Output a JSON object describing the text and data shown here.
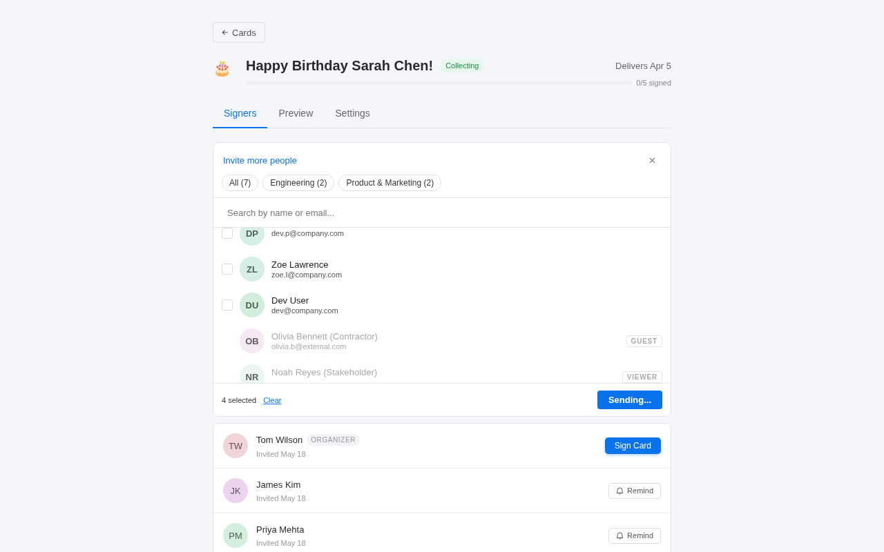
{
  "back_button": {
    "label": "Cards"
  },
  "header": {
    "emoji": "🎂",
    "title": "Happy Birthday Sarah Chen!",
    "status": "Collecting",
    "delivery": "Delivers Apr 5",
    "progress": {
      "level": 0,
      "reading": "0/5 signed"
    }
  },
  "tabs": [
    {
      "label": "Signers",
      "selected": true
    },
    {
      "label": "Preview",
      "selected": false
    },
    {
      "label": "Settings",
      "selected": false
    }
  ],
  "invite_panel": {
    "title": "Invite more people",
    "filters": [
      "All (7)",
      "Engineering (2)",
      "Product & Marketing (2)"
    ],
    "search": {
      "placeholder": "Search by name or email..."
    },
    "people": [
      {
        "initials": "DP",
        "email": "dev.p@company.com",
        "color": "#d5eee6",
        "disabled": false,
        "checked": false
      },
      {
        "initials": "ZL",
        "name": "Zoe Lawrence",
        "email": "zoe.l@company.com",
        "color": "#d5eee6",
        "disabled": false,
        "checked": false
      },
      {
        "initials": "DU",
        "name": "Dev User",
        "email": "dev@company.com",
        "color": "#d3eedc",
        "disabled": false,
        "checked": false
      },
      {
        "initials": "OB",
        "name": "Olivia Bennett (Contractor)",
        "email": "olivia.b@external.com",
        "color": "#f6e9f5",
        "disabled": true,
        "badge": "GUEST"
      },
      {
        "initials": "NR",
        "name": "Noah Reyes (Stakeholder)",
        "color": "#e9f6f2",
        "disabled": true,
        "badge": "VIEWER"
      }
    ],
    "footer": {
      "selected_count": "4 selected",
      "clear": "Clear",
      "send": "Sending..."
    }
  },
  "signers": [
    {
      "initials": "TW",
      "name": "Tom Wilson",
      "role": "ORGANIZER",
      "invited": "Invited May 18",
      "color": "#f0d4d8",
      "action": {
        "kind": "primary",
        "label": "Sign Card"
      }
    },
    {
      "initials": "JK",
      "name": "James Kim",
      "invited": "Invited May 18",
      "color": "#ecd3ee",
      "action": {
        "kind": "remind",
        "label": "Remind"
      }
    },
    {
      "initials": "PM",
      "name": "Priya Mehta",
      "invited": "Invited May 18",
      "color": "#d3eedc",
      "action": {
        "kind": "remind",
        "label": "Remind"
      }
    }
  ]
}
